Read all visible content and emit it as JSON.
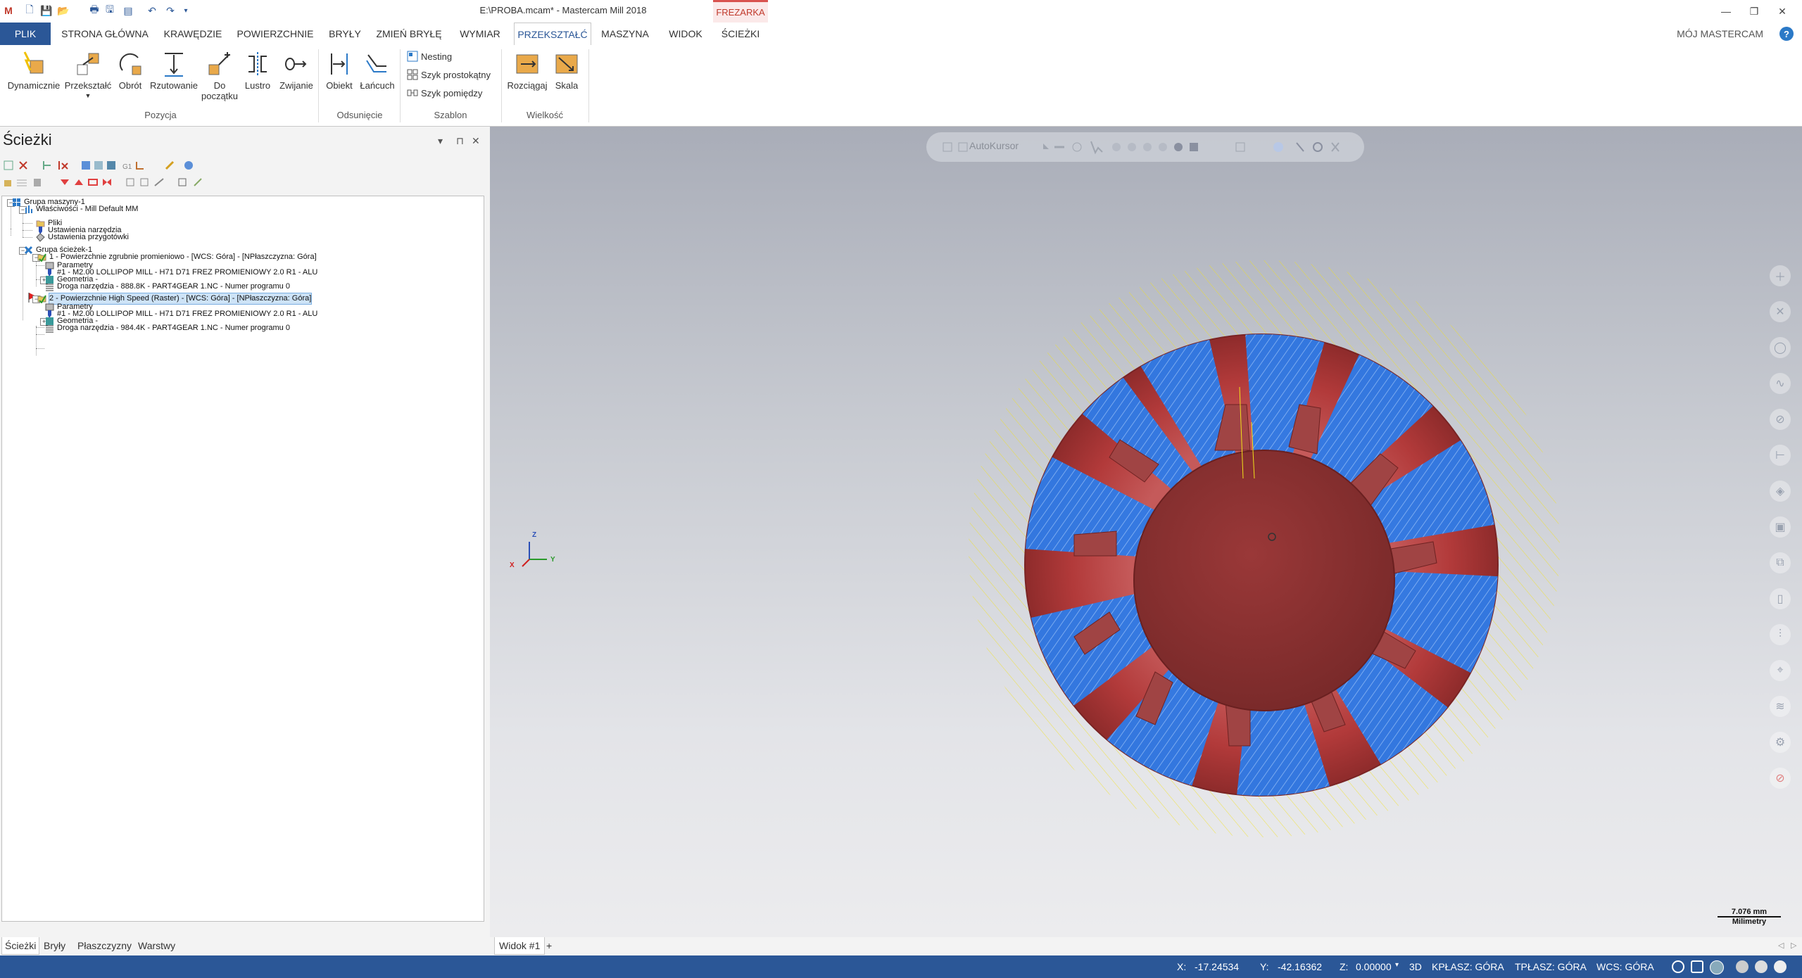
{
  "window": {
    "title": "E:\\PROBA.mcam* - Mastercam Mill 2018",
    "context_tab": "FREZARKA",
    "controls": [
      "—",
      "❐",
      "✕"
    ]
  },
  "tabs": [
    "PLIK",
    "STRONA GŁÓWNA",
    "KRAWĘDZIE",
    "POWIERZCHNIE",
    "BRYŁY",
    "ZMIEŃ BRYŁĘ",
    "WYMIAR",
    "PRZEKSZTAŁĆ",
    "MASZYNA",
    "WIDOK",
    "ŚCIEŻKI"
  ],
  "active_tab": "PRZEKSZTAŁĆ",
  "my_mastercam": "MÓJ MASTERCAM",
  "help_glyph": "?",
  "ribbon": {
    "pozycja": {
      "label": "Pozycja",
      "buttons": [
        "Dynamicznie",
        "Przekształć",
        "Obrót",
        "Rzutowanie",
        "Do",
        "początku",
        "Lustro",
        "Zwijanie"
      ]
    },
    "odsuniecie": {
      "label": "Odsunięcie",
      "buttons": [
        "Obiekt",
        "Łańcuch"
      ]
    },
    "szablon": {
      "label": "Szablon",
      "buttons": [
        "Nesting",
        "Szyk prostokątny",
        "Szyk pomiędzy"
      ]
    },
    "wielkosc": {
      "label": "Wielkość",
      "buttons": [
        "Rozciągaj",
        "Skala"
      ]
    }
  },
  "panel": {
    "title": "Ścieżki",
    "controls": [
      "▾",
      "⊓",
      "✕"
    ],
    "tree": [
      "Grupa maszyny-1",
      "Właściwości - Mill Default MM",
      "Pliki",
      "Ustawienia narzędzia",
      "Ustawienia przygotówki",
      "Grupa ścieżek-1",
      "1 - Powierzchnie zgrubnie promieniowo - [WCS: Góra] - [NPłaszczyzna: Góra]",
      "Parametry",
      "#1 - M2.00 LOLLIPOP MILL - H71 D71 FREZ PROMIENIOWY 2.0 R1 - ALU",
      "Geometria -",
      "Droga narzędzia - 888.8K - PART4GEAR 1.NC - Numer programu 0",
      "2 - Powierzchnie High Speed (Raster) - [WCS: Góra] - [NPłaszczyzna: Góra]",
      "Parametry",
      "#1 - M2.00 LOLLIPOP MILL - H71 D71 FREZ PROMIENIOWY 2.0 R1 - ALU",
      "Geometria -",
      "Droga narzędzia - 984.4K - PART4GEAR 1.NC - Numer programu 0"
    ],
    "bottom_tabs": [
      "Ścieżki",
      "Bryły",
      "Płaszczyzny",
      "Warstwy"
    ]
  },
  "viewport": {
    "autocursor": "AutoKursor",
    "axis": {
      "x": "X",
      "y": "Y",
      "z": "Z"
    },
    "scale_value": "7.076 mm",
    "scale_unit": "Milimetry",
    "view_tab": "Widok #1",
    "add_tab": "+"
  },
  "status": {
    "x_label": "X:",
    "x_value": "-17.24534",
    "y_label": "Y:",
    "y_value": "-42.16362",
    "z_label": "Z:",
    "z_value": "0.00000",
    "mode": "3D",
    "kplane": "KPŁASZ: GÓRA",
    "tplane": "TPŁASZ: GÓRA",
    "wcs": "WCS: GÓRA"
  },
  "colors": {
    "accent": "#2b5797",
    "part": "#a83a3a",
    "toolpath_blue": "#1f6fe0",
    "toolpath_yellow": "#f2e21a"
  }
}
